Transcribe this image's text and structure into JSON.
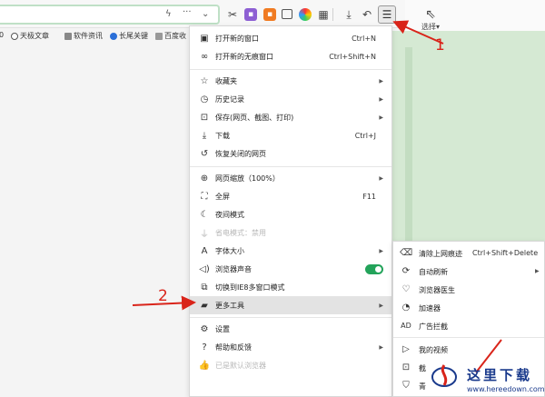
{
  "toolbar": {
    "extension_icons": [
      "cut-icon",
      "purple-extension-icon",
      "orange-extension-icon",
      "screen-icon",
      "colorful-extension-icon",
      "apps-grid-icon"
    ],
    "download_icon": "download-icon",
    "undo_icon": "undo-icon",
    "menu_icon": "hamburger-menu-icon"
  },
  "bookmarks": [
    {
      "label": "0"
    },
    {
      "label": "天极文章"
    },
    {
      "label": "软件资讯"
    },
    {
      "label": "长尾关键"
    },
    {
      "label": "百度收"
    }
  ],
  "side_panel": {
    "select_label": "选择"
  },
  "menu": {
    "items": [
      {
        "label": "打开新的窗口",
        "shortcut": "Ctrl+N"
      },
      {
        "label": "打开新的无痕窗口",
        "shortcut": "Ctrl+Shift+N"
      },
      {
        "label": "收藏夹",
        "shortcut": ""
      },
      {
        "label": "历史记录",
        "shortcut": ""
      },
      {
        "label": "保存(网页、截图、打印)",
        "shortcut": ""
      },
      {
        "label": "下载",
        "shortcut": "Ctrl+J"
      },
      {
        "label": "恢复关闭的网页",
        "shortcut": ""
      },
      {
        "label": "网页缩放（100%）",
        "shortcut": ""
      },
      {
        "label": "全屏",
        "shortcut": "F11"
      },
      {
        "label": "夜间模式",
        "shortcut": ""
      },
      {
        "label": "省电模式：禁用",
        "shortcut": ""
      },
      {
        "label": "字体大小",
        "shortcut": ""
      },
      {
        "label": "浏览器声音",
        "shortcut": ""
      },
      {
        "label": "切换到IE8多窗口模式",
        "shortcut": ""
      },
      {
        "label": "更多工具",
        "shortcut": ""
      },
      {
        "label": "设置",
        "shortcut": ""
      },
      {
        "label": "帮助和反馈",
        "shortcut": ""
      },
      {
        "label": "已是默认浏览器",
        "shortcut": ""
      }
    ],
    "sound_enabled": true
  },
  "submenu": {
    "items": [
      {
        "label": "清除上网痕迹",
        "shortcut": "Ctrl+Shift+Delete"
      },
      {
        "label": "自动刷新",
        "shortcut": ""
      },
      {
        "label": "浏览器医生",
        "shortcut": ""
      },
      {
        "label": "加速器",
        "shortcut": ""
      },
      {
        "label": "广告拦截",
        "shortcut": ""
      },
      {
        "label": "我的视频",
        "shortcut": ""
      },
      {
        "label": "截",
        "shortcut": ""
      },
      {
        "label": "青",
        "shortcut": ""
      }
    ]
  },
  "annotations": {
    "step1": "1",
    "step2": "2"
  },
  "watermark": {
    "title": "这里下载",
    "url": "www.hereedown.com"
  },
  "colors": {
    "accent_red": "#d9241a",
    "toggle_green": "#23a35a",
    "panel_green": "#d5e9d3"
  }
}
